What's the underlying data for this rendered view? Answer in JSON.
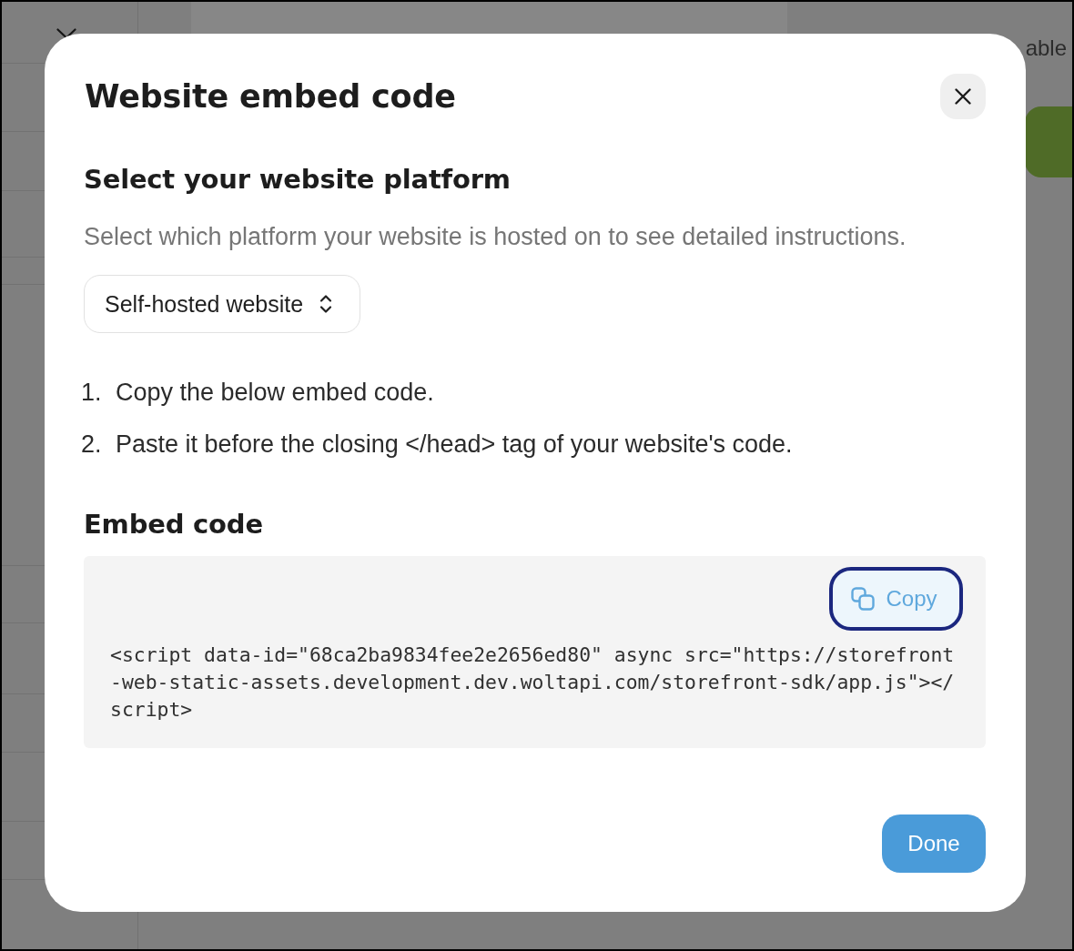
{
  "page_behind": {
    "text_fragment": "able"
  },
  "dialog": {
    "title": "Website embed code",
    "platform_section": {
      "heading": "Select your website platform",
      "description": "Select which platform your website is hosted on to see detailed instructions.",
      "select": {
        "value": "Self-hosted website"
      }
    },
    "steps": [
      {
        "number": "1.",
        "text": "Copy the below embed code."
      },
      {
        "number": "2.",
        "text": "Paste it before the closing </head> tag of your website's code."
      }
    ],
    "embed_section": {
      "heading": "Embed code",
      "code": "<script data-id=\"68ca2ba9834fee2e2656ed80\" async src=\"https://storefront-web-static-assets.development.dev.woltapi.com/storefront-sdk/app.js\"></script>",
      "copy_button": {
        "label": "Copy",
        "focused": true
      }
    },
    "done_button": {
      "label": "Done"
    }
  }
}
